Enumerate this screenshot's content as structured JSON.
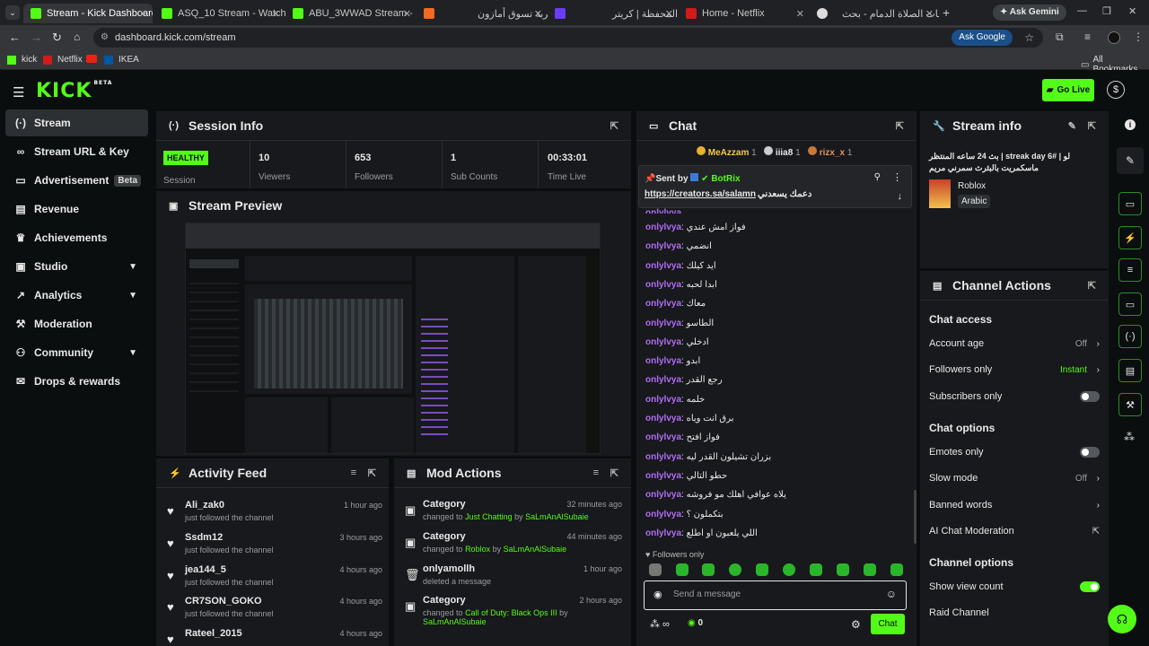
{
  "browser": {
    "tabs": [
      {
        "title": "Stream - Kick Dashboard"
      },
      {
        "title": "ASQ_10 Stream - Watch Live"
      },
      {
        "title": "ABU_3WWAD Stream - "
      },
      {
        "title": "عربة تسوق أمازون"
      },
      {
        "title": "المحفظة | كريتر"
      },
      {
        "title": "Home - Netflix"
      },
      {
        "title": "اوقات الصلاة الدمام - بحث"
      }
    ],
    "ask_gemini": "Ask Gemini",
    "url": "dashboard.kick.com/stream",
    "ask_google": "Ask Google",
    "bookmarks": [
      "kick",
      "Netflix",
      "IKEA"
    ],
    "all_bookmarks": "All Bookmarks"
  },
  "app": {
    "logo": "KICK",
    "logo_badge": "BETA",
    "go_live": "Go Live"
  },
  "sidebar": {
    "items": [
      {
        "label": "Stream",
        "icon": "broadcast-icon"
      },
      {
        "label": "Stream URL & Key",
        "icon": "link-icon"
      },
      {
        "label": "Advertisement",
        "badge": "Beta",
        "icon": "ad-icon"
      },
      {
        "label": "Revenue",
        "icon": "revenue-icon"
      },
      {
        "label": "Achievements",
        "icon": "trophy-icon"
      },
      {
        "label": "Studio",
        "icon": "studio-icon"
      },
      {
        "label": "Analytics",
        "icon": "analytics-icon"
      },
      {
        "label": "Moderation",
        "icon": "hammer-icon"
      },
      {
        "label": "Community",
        "icon": "people-icon"
      },
      {
        "label": "Drops & rewards",
        "icon": "gift-icon"
      }
    ]
  },
  "session": {
    "title": "Session Info",
    "status": "HEALTHY",
    "status_label": "Session",
    "stats": [
      {
        "value": "10",
        "label": "Viewers"
      },
      {
        "value": "653",
        "label": "Followers"
      },
      {
        "value": "1",
        "label": "Sub Counts"
      },
      {
        "value": "00:33:01",
        "label": "Time Live"
      }
    ]
  },
  "preview": {
    "title": "Stream Preview"
  },
  "activity": {
    "title": "Activity Feed",
    "items": [
      {
        "name": "Ali_zak0",
        "sub": "just followed the channel",
        "time": "1 hour ago"
      },
      {
        "name": "Ssdm12",
        "sub": "just followed the channel",
        "time": "3 hours ago"
      },
      {
        "name": "jea144_5",
        "sub": "just followed the channel",
        "time": "4 hours ago"
      },
      {
        "name": "CR7SON_GOKO",
        "sub": "just followed the channel",
        "time": "4 hours ago"
      },
      {
        "name": "Rateel_2015",
        "sub": "",
        "time": "4 hours ago"
      }
    ]
  },
  "mod_actions": {
    "title": "Mod Actions",
    "items": [
      {
        "name": "Category",
        "pre": "changed to",
        "target": "Just Chatting",
        "by": "by",
        "user": "SaLmAnAlSubaie",
        "time": "32 minutes ago"
      },
      {
        "name": "Category",
        "pre": "changed to",
        "target": "Roblox",
        "by": "by",
        "user": "SaLmAnAlSubaie",
        "time": "44 minutes ago"
      },
      {
        "name": "onlyamollh",
        "pre": "deleted a message",
        "target": "",
        "by": "",
        "user": "",
        "time": "1 hour ago"
      },
      {
        "name": "Category",
        "pre": "changed to",
        "target": "Call of Duty: Black Ops III",
        "by": "by",
        "user": "SaLmAnAlSubaie",
        "time": "2 hours ago"
      }
    ]
  },
  "chat": {
    "title": "Chat",
    "top_gifters": [
      {
        "name": "MeAzzam",
        "count": "1"
      },
      {
        "name": "iiia8",
        "count": "1"
      },
      {
        "name": "rizx_x",
        "count": "1"
      }
    ],
    "pinned": {
      "sent_by": "Sent by",
      "bot": "BotRix",
      "link": "https://creators.sa/salamn",
      "text": "دعمك يسعدني"
    },
    "partial_user": "onlylvya",
    "messages": [
      {
        "user": "onlylvya",
        "text": "فواز امش عندي"
      },
      {
        "user": "onlylvya",
        "text": "انضمي"
      },
      {
        "user": "onlylvya",
        "text": "ايد كيلك"
      },
      {
        "user": "onlylvya",
        "text": "ابدا لحبه"
      },
      {
        "user": "onlylvya",
        "text": "معاك"
      },
      {
        "user": "onlylvya",
        "text": "الطاسو"
      },
      {
        "user": "onlylvya",
        "text": "ادخلي"
      },
      {
        "user": "onlylvya",
        "text": "ابدو"
      },
      {
        "user": "onlylvya",
        "text": "رجع القدر"
      },
      {
        "user": "onlylvya",
        "text": "خلمه"
      },
      {
        "user": "onlylvya",
        "text": "برق انت وياه"
      },
      {
        "user": "onlylvya",
        "text": "فواز افتح"
      },
      {
        "user": "onlylvya",
        "text": "بزران تشيلون القدر ليه"
      },
      {
        "user": "onlylvya",
        "text": "حطو التالي"
      },
      {
        "user": "onlylvya",
        "text": "يلاه عوافي اهلك مو فروشه"
      },
      {
        "user": "onlylvya",
        "text": "بتكملون ؟"
      },
      {
        "user": "onlylvya",
        "text": "اللي يلعبون او اطلع"
      }
    ],
    "followers_only": "Followers only",
    "placeholder": "Send a message",
    "points": "0",
    "send": "Chat"
  },
  "stream_info": {
    "title": "Stream info",
    "stream_title": "لو | streak day 6# | بث 24 ساعه المنتظر ماسكمريت بالبثرث سمرني مريم",
    "category": "Roblox",
    "language": "Arabic"
  },
  "channel_actions": {
    "title": "Channel Actions",
    "chat_access": "Chat access",
    "account_age": {
      "label": "Account age",
      "value": "Off"
    },
    "followers_only": {
      "label": "Followers only",
      "value": "Instant"
    },
    "subscribers_only": {
      "label": "Subscribers only",
      "on": false
    },
    "chat_options": "Chat options",
    "emotes_only": {
      "label": "Emotes only",
      "on": false
    },
    "slow_mode": {
      "label": "Slow mode",
      "value": "Off"
    },
    "banned_words": {
      "label": "Banned words"
    },
    "ai_moderation": {
      "label": "AI Chat Moderation"
    },
    "channel_options": "Channel options",
    "show_view_count": {
      "label": "Show view count",
      "on": true
    },
    "raid_channel": {
      "label": "Raid Channel"
    }
  },
  "colors": {
    "accent": "#53fc18",
    "username": "#b06cf5",
    "panel": "#18191c",
    "bg": "#0b0e0f"
  }
}
